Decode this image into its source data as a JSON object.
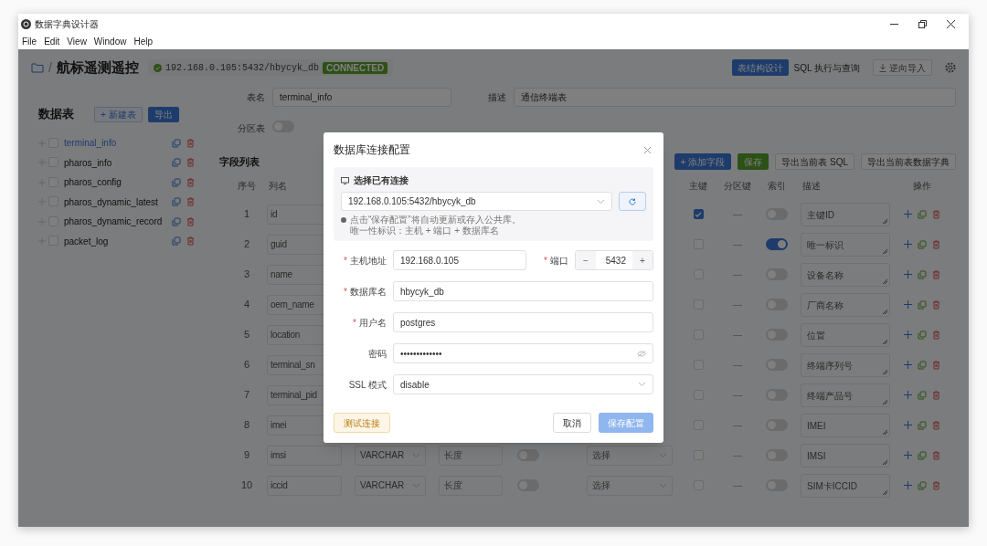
{
  "window": {
    "title": "数据字典设计器"
  },
  "menu": [
    "File",
    "Edit",
    "View",
    "Window",
    "Help"
  ],
  "header": {
    "separator": "/",
    "project": "航标遥测遥控",
    "connection": "192.168.0.105:5432/hbycyk_db",
    "status": "CONNECTED",
    "view_tabs": [
      {
        "label": "表结构设计",
        "selected": true
      },
      {
        "label": "SQL 执行与查询",
        "selected": false
      }
    ],
    "import_button": "逆向导入"
  },
  "sidebar": {
    "title": "数据表",
    "new_button": "+ 新建表",
    "export_button": "导出",
    "tables": [
      {
        "name": "terminal_info",
        "selected": true,
        "checked": false
      },
      {
        "name": "pharos_info",
        "selected": false,
        "checked": false
      },
      {
        "name": "pharos_config",
        "selected": false,
        "checked": false
      },
      {
        "name": "pharos_dynamic_latest",
        "selected": false,
        "checked": false
      },
      {
        "name": "pharos_dynamic_record",
        "selected": false,
        "checked": false
      },
      {
        "name": "packet_log",
        "selected": false,
        "checked": false
      }
    ]
  },
  "table_form": {
    "name_label": "表名",
    "name_value": "terminal_info",
    "desc_label": "描述",
    "desc_value": "通信终端表",
    "partition_label": "分区表",
    "partition_on": false
  },
  "fields": {
    "title": "字段列表",
    "actions": [
      {
        "label": "+ 添加字段",
        "kind": "primary"
      },
      {
        "label": "保存",
        "kind": "success"
      },
      {
        "label": "导出当前表 SQL",
        "kind": "default"
      },
      {
        "label": "导出当前表数据字典",
        "kind": "default"
      }
    ],
    "columns": {
      "index": "序号",
      "name": "列名",
      "primary_key": "主键",
      "partition_key": "分区键",
      "indexed": "索引",
      "description": "描述",
      "actions": "操作"
    },
    "rows": [
      {
        "index": "1",
        "name": "id",
        "primary_key": true,
        "partition_key": "—",
        "indexed": false,
        "description": "主键ID"
      },
      {
        "index": "2",
        "name": "guid",
        "primary_key": false,
        "partition_key": "—",
        "indexed": true,
        "description": "唯一标识"
      },
      {
        "index": "3",
        "name": "name",
        "primary_key": false,
        "partition_key": "—",
        "indexed": false,
        "description": "设备名称"
      },
      {
        "index": "4",
        "name": "oem_name",
        "primary_key": false,
        "partition_key": "—",
        "indexed": false,
        "description": "厂商名称"
      },
      {
        "index": "5",
        "name": "location",
        "primary_key": false,
        "partition_key": "—",
        "indexed": false,
        "description": "位置"
      },
      {
        "index": "6",
        "name": "terminal_sn",
        "primary_key": false,
        "partition_key": "—",
        "indexed": false,
        "description": "终端序列号"
      },
      {
        "index": "7",
        "name": "terminal_pid",
        "primary_key": false,
        "partition_key": "—",
        "indexed": false,
        "description": "终端产品号"
      },
      {
        "index": "8",
        "name": "imei",
        "primary_key": false,
        "partition_key": "—",
        "indexed": false,
        "description": "IMEI"
      },
      {
        "index": "9",
        "name": "imsi",
        "type": "VARCHAR",
        "length_placeholder": "长度",
        "switch_on": false,
        "option_placeholder": "选择",
        "primary_key": false,
        "partition_key": "—",
        "indexed": false,
        "description": "IMSI"
      },
      {
        "index": "10",
        "name": "iccid",
        "type": "VARCHAR",
        "length_placeholder": "长度",
        "switch_on": false,
        "option_placeholder": "选择",
        "primary_key": false,
        "partition_key": "—",
        "indexed": false,
        "description": "SIM卡ICCID"
      }
    ]
  },
  "dialog": {
    "title": "数据库连接配置",
    "required_mark": "*",
    "existing_label": "选择已有连接",
    "existing_value": "192.168.0.105:5432/hbycyk_db",
    "notes": [
      "点击“保存配置”将自动更新或存入公共库。",
      "唯一性标识：主机 + 端口 + 数据库名"
    ],
    "host": {
      "label": "主机地址",
      "required": true,
      "value": "192.168.0.105"
    },
    "port": {
      "label": "端口",
      "required": true,
      "value": "5432",
      "minus": "−",
      "plus": "+"
    },
    "fields": [
      {
        "label": "数据库名",
        "required": true,
        "value": "hbycyk_db",
        "kind": "text"
      },
      {
        "label": "用户名",
        "required": true,
        "value": "postgres",
        "kind": "text"
      },
      {
        "label": "密码",
        "required": false,
        "value": "•••••••••••••",
        "kind": "password"
      },
      {
        "label": "SSL 模式",
        "required": false,
        "value": "disable",
        "kind": "select"
      }
    ],
    "test_button": "测试连接",
    "cancel_button": "取消",
    "save_button": {
      "label": "保存配置",
      "disabled": true
    }
  }
}
